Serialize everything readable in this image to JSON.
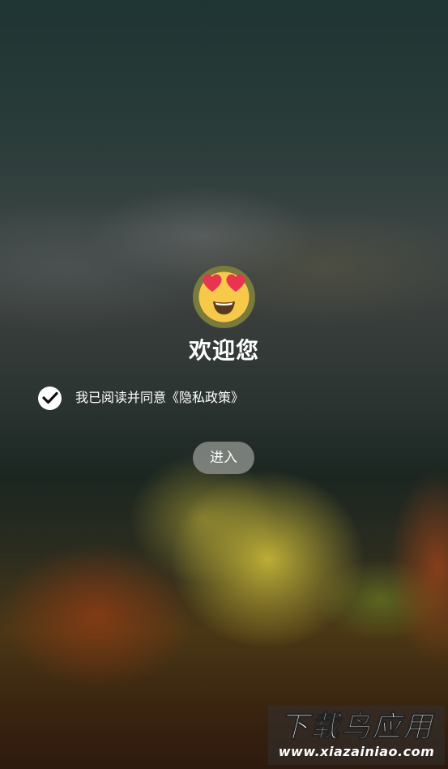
{
  "welcome": {
    "emoji_icon": "heart-eyes-face-icon",
    "title": "欢迎您"
  },
  "agreement": {
    "checked": true,
    "text": "我已阅读并同意《隐私政策》"
  },
  "enter_button": {
    "label": "进入"
  },
  "watermark": {
    "main": "下载鸟应用",
    "sub": "www.xiazainiao.com"
  },
  "colors": {
    "text": "#ffffff",
    "button_bg": "#878c87",
    "emoji_face": "#f7c94a",
    "emoji_ring": "#7a7a3c",
    "hearts": "#e8344f"
  }
}
